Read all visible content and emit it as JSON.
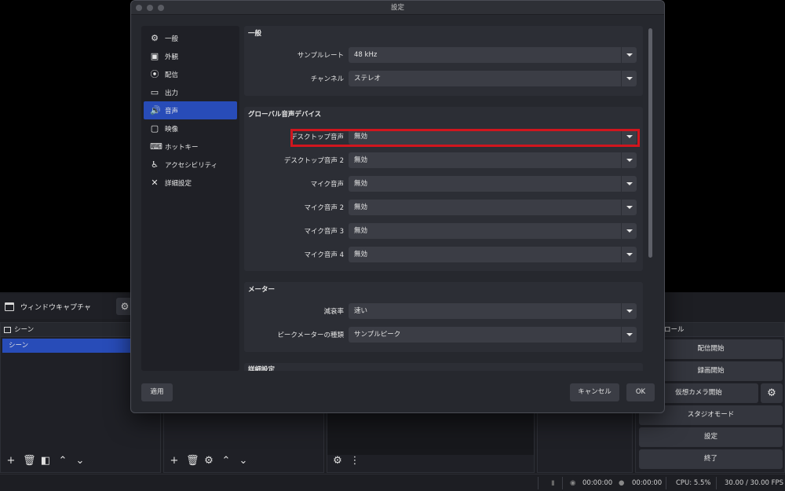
{
  "app": {
    "source_name": "ウィンドウキャプチャ",
    "scenes_header": "シーン",
    "scene_item": "シーン",
    "controls_header": "ロール",
    "controls": {
      "start_stream": "配信開始",
      "start_record": "録画開始",
      "virtual_cam": "仮想カメラ開始",
      "studio_mode": "スタジオモード",
      "settings": "設定",
      "exit": "終了"
    },
    "status": {
      "stream_time": "00:00:00",
      "record_time": "00:00:00",
      "cpu": "CPU: 5.5%",
      "fps": "30.00 / 30.00 FPS"
    }
  },
  "dialog": {
    "title": "設定",
    "nav": [
      {
        "label": "一般",
        "icon": "gear-icon",
        "glyph": "⚙"
      },
      {
        "label": "外観",
        "icon": "appearance-icon",
        "glyph": "▣"
      },
      {
        "label": "配信",
        "icon": "broadcast-icon",
        "glyph": "⦿"
      },
      {
        "label": "出力",
        "icon": "output-icon",
        "glyph": "▭"
      },
      {
        "label": "音声",
        "icon": "speaker-icon",
        "glyph": "🔊"
      },
      {
        "label": "映像",
        "icon": "monitor-icon",
        "glyph": "▢"
      },
      {
        "label": "ホットキー",
        "icon": "keyboard-icon",
        "glyph": "⌨"
      },
      {
        "label": "アクセシビリティ",
        "icon": "accessibility-icon",
        "glyph": "♿"
      },
      {
        "label": "詳細設定",
        "icon": "tools-icon",
        "glyph": "✕"
      }
    ],
    "active_nav": "音声",
    "sections": {
      "general": {
        "title": "一般",
        "sample_rate_label": "サンプルレート",
        "sample_rate_value": "48 kHz",
        "channels_label": "チャンネル",
        "channels_value": "ステレオ"
      },
      "global_audio": {
        "title": "グローバル音声デバイス",
        "rows": [
          {
            "label": "デスクトップ音声",
            "value": "無効"
          },
          {
            "label": "デスクトップ音声 2",
            "value": "無効"
          },
          {
            "label": "マイク音声",
            "value": "無効"
          },
          {
            "label": "マイク音声 2",
            "value": "無効"
          },
          {
            "label": "マイク音声 3",
            "value": "無効"
          },
          {
            "label": "マイク音声 4",
            "value": "無効"
          }
        ]
      },
      "meters": {
        "title": "メーター",
        "decay_label": "減衰率",
        "decay_value": "速い",
        "peak_label": "ピークメーターの種類",
        "peak_value": "サンプルピーク"
      },
      "advanced": {
        "title": "詳細設定"
      }
    },
    "buttons": {
      "apply": "適用",
      "cancel": "キャンセル",
      "ok": "OK"
    }
  },
  "colors": {
    "accent": "#284cb8",
    "highlight_box": "#d0161e"
  }
}
